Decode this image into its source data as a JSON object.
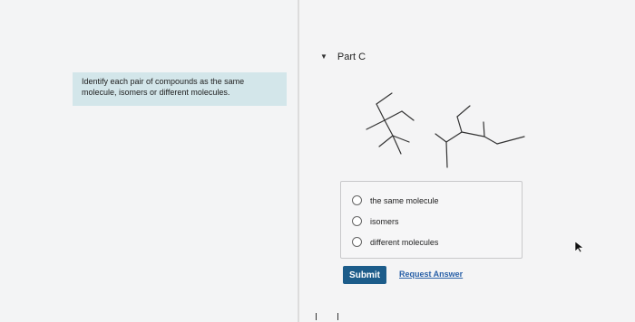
{
  "instruction": {
    "line1": "Identify each pair of compounds as the same",
    "line2": "molecule, isomers or different molecules."
  },
  "part": {
    "label": "Part C"
  },
  "choices": [
    {
      "label": "the same molecule"
    },
    {
      "label": "isomers"
    },
    {
      "label": "different molecules"
    }
  ],
  "actions": {
    "submit_label": "Submit",
    "request_label": "Request Answer"
  },
  "icons": {
    "part_toggle": "caret-down-icon",
    "cursor": "mouse-pointer-icon"
  },
  "colors": {
    "instruction_bg": "#d3e6ea",
    "submit_bg": "#1c5c8a",
    "link": "#2a61a8"
  }
}
